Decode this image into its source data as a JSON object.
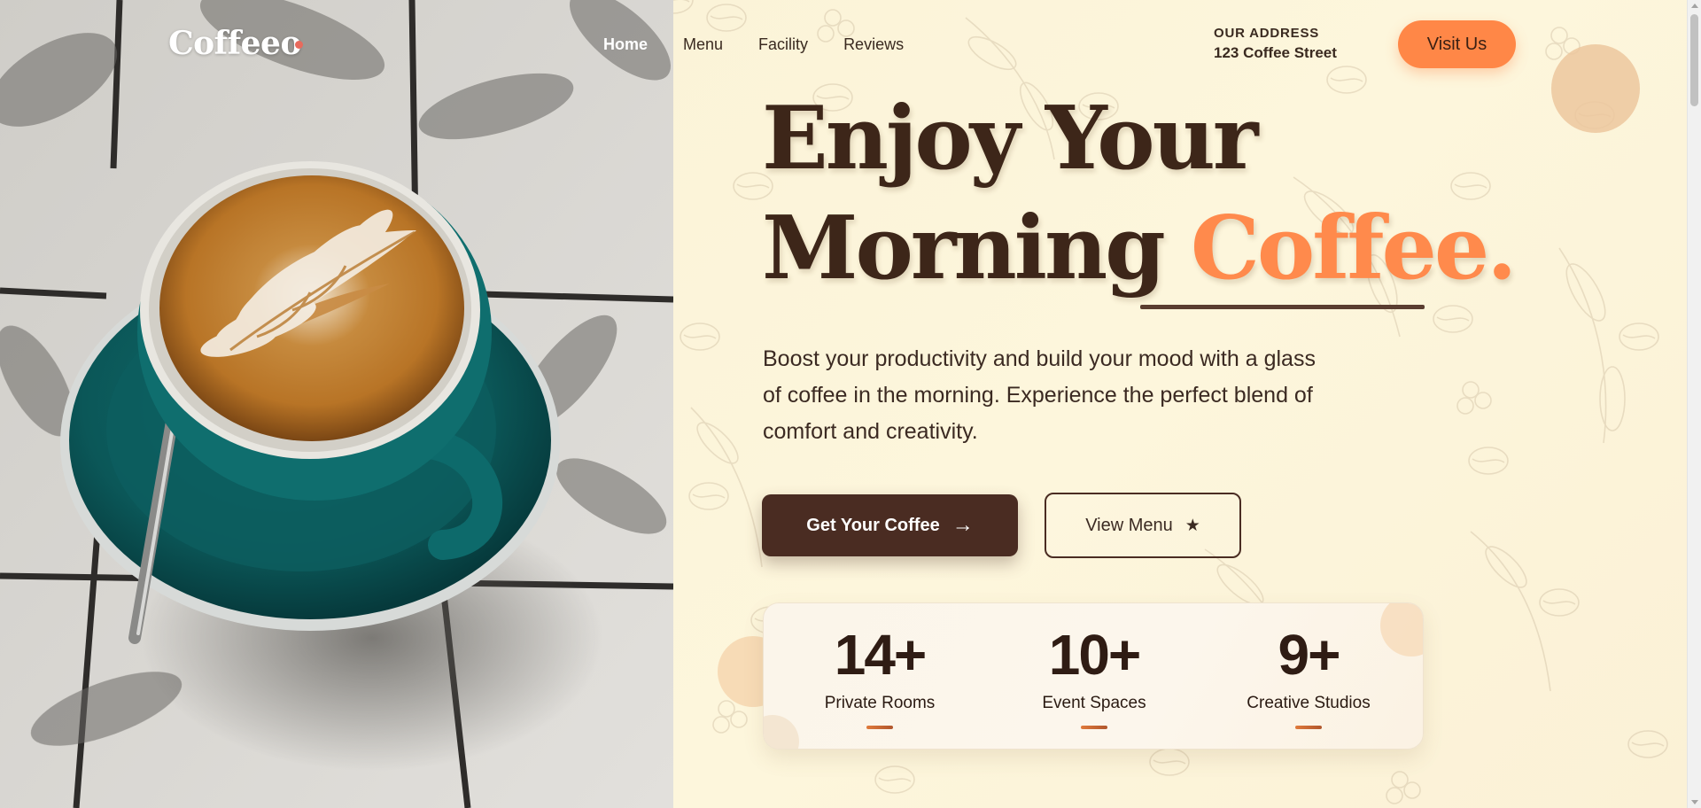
{
  "brand": {
    "logo_text": "Coffeeo",
    "accent_color": "#ff8a4c",
    "dark_color": "#3d2619"
  },
  "nav": {
    "items": [
      {
        "label": "Home",
        "active": true
      },
      {
        "label": "Menu",
        "active": false
      },
      {
        "label": "Facility",
        "active": false
      },
      {
        "label": "Reviews",
        "active": false
      }
    ]
  },
  "address": {
    "label": "OUR ADDRESS",
    "value": "123 Coffee Street"
  },
  "visit_button": {
    "label": "Visit Us"
  },
  "hero": {
    "line1": "Enjoy Your",
    "line2_plain": "Morning",
    "line2_accent": "Coffee.",
    "description": "Boost your productivity and build your mood with a glass of coffee in the morning. Experience the perfect blend of comfort and creativity."
  },
  "buttons": {
    "primary_label": "Get Your Coffee",
    "primary_icon": "arrow-right-icon",
    "secondary_label": "View Menu",
    "secondary_icon": "star-icon"
  },
  "stats": [
    {
      "value": "14+",
      "label": "Private Rooms"
    },
    {
      "value": "10+",
      "label": "Event Spaces"
    },
    {
      "value": "9+",
      "label": "Creative Studios"
    }
  ],
  "image": {
    "subject": "latte-art-cup-photo"
  }
}
